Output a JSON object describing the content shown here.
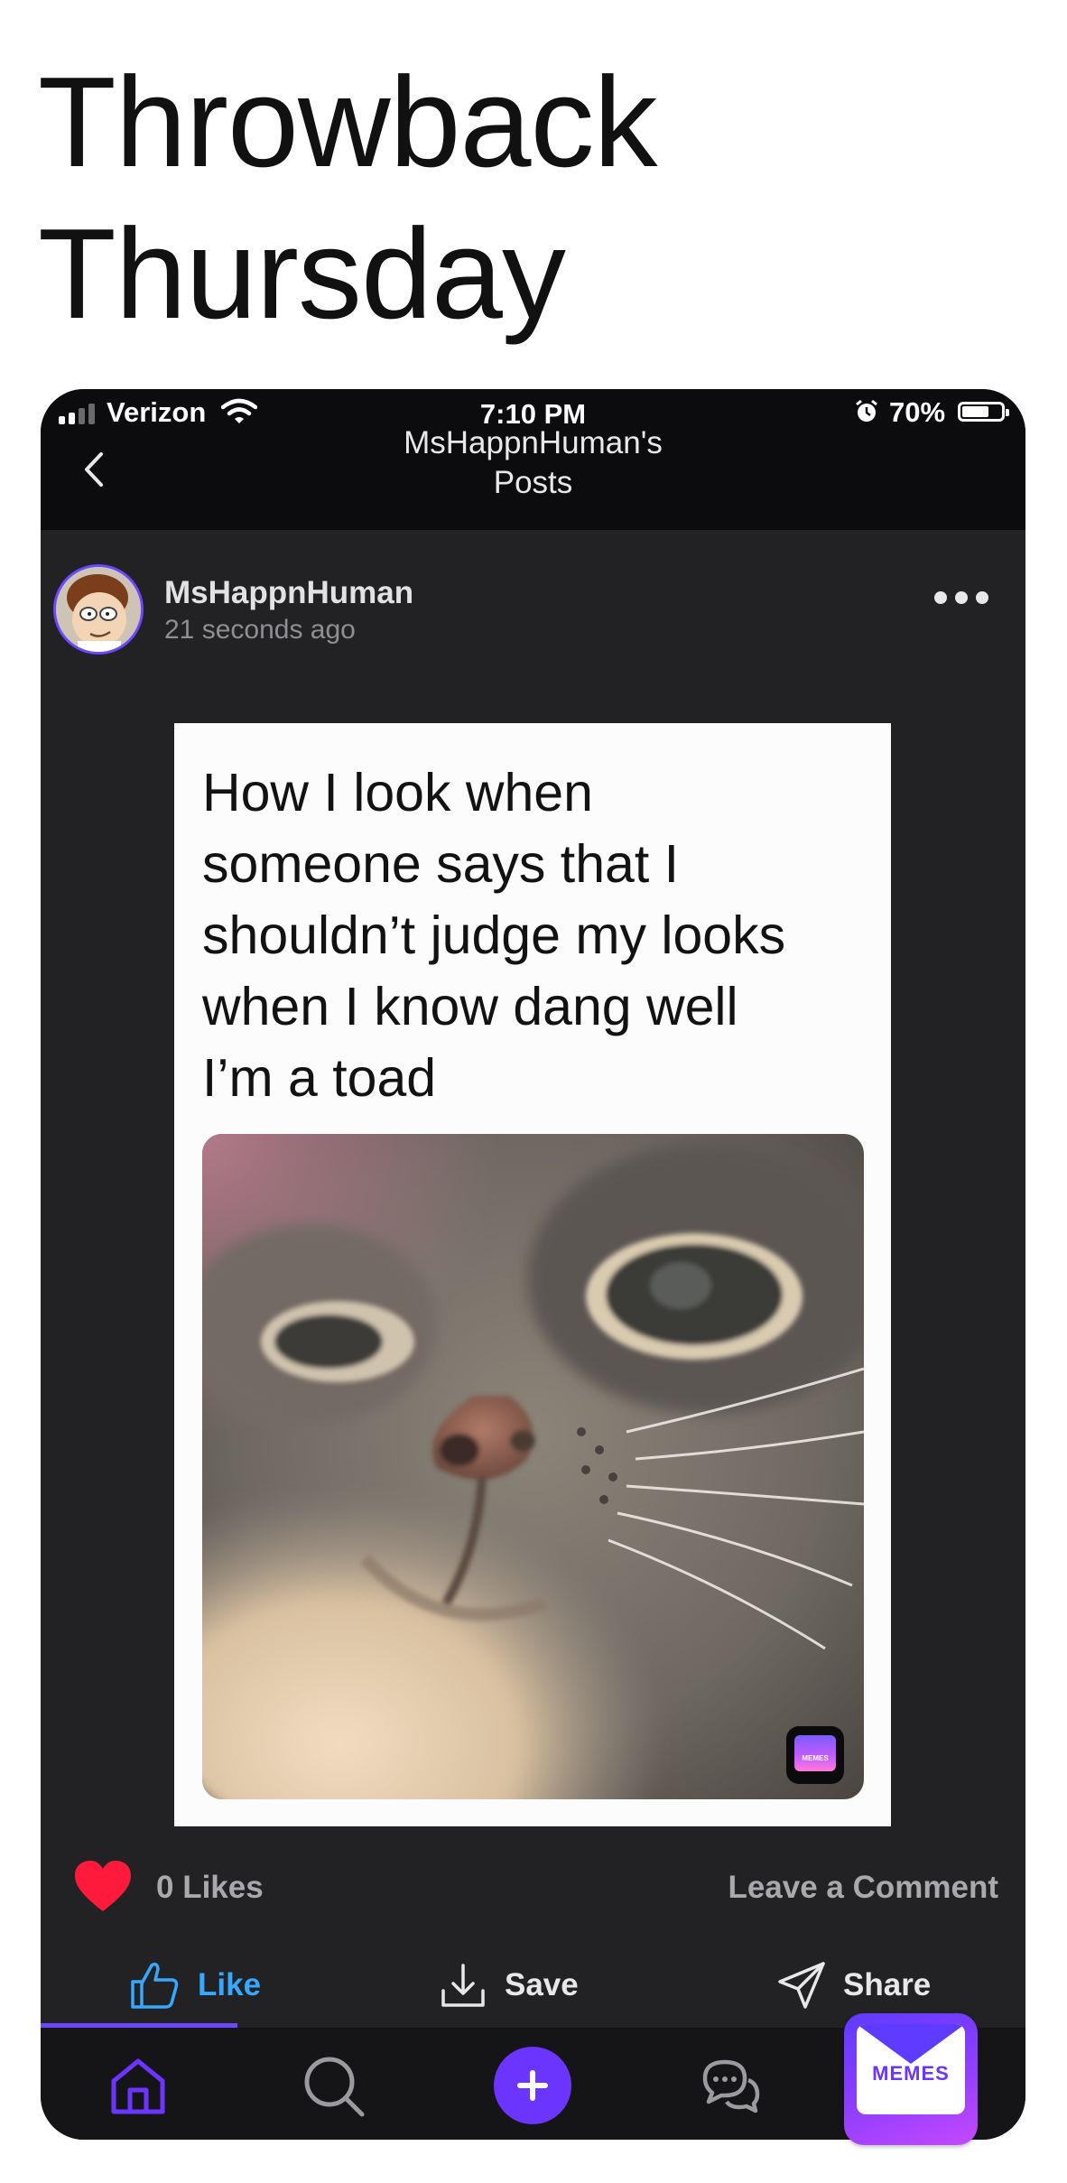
{
  "headline": {
    "line1": "Throwback",
    "line2": "Thursday"
  },
  "status_bar": {
    "carrier": "Verizon",
    "time": "7:10 PM",
    "battery": "70%",
    "battery_level": 0.7
  },
  "nav": {
    "title_line1": "MsHappnHuman's",
    "title_line2": "Posts",
    "back_icon": "chevron-left-icon"
  },
  "post": {
    "username": "MsHappnHuman",
    "timestamp": "21 seconds ago",
    "more_icon": "ellipsis-icon",
    "meme_text": {
      "line1": "How I look when",
      "line2": "someone says that I",
      "line3": "shouldn’t judge my looks",
      "line4": "when I know dang well",
      "line5": "I’m a toad"
    },
    "image_badge": "MEMES",
    "likes": "0 Likes",
    "comment_link": "Leave a Comment"
  },
  "actions": {
    "like": "Like",
    "save": "Save",
    "share": "Share"
  },
  "tabbar": {
    "items": [
      "home-icon",
      "search-icon",
      "add-icon",
      "chat-icon",
      "profile-avatar"
    ]
  },
  "watermark": {
    "label": "MEMES"
  },
  "colors": {
    "accent_purple": "#6b35ff",
    "like_blue": "#36a8ff",
    "heart_red": "#ff1a3c",
    "surface": "#222224"
  }
}
